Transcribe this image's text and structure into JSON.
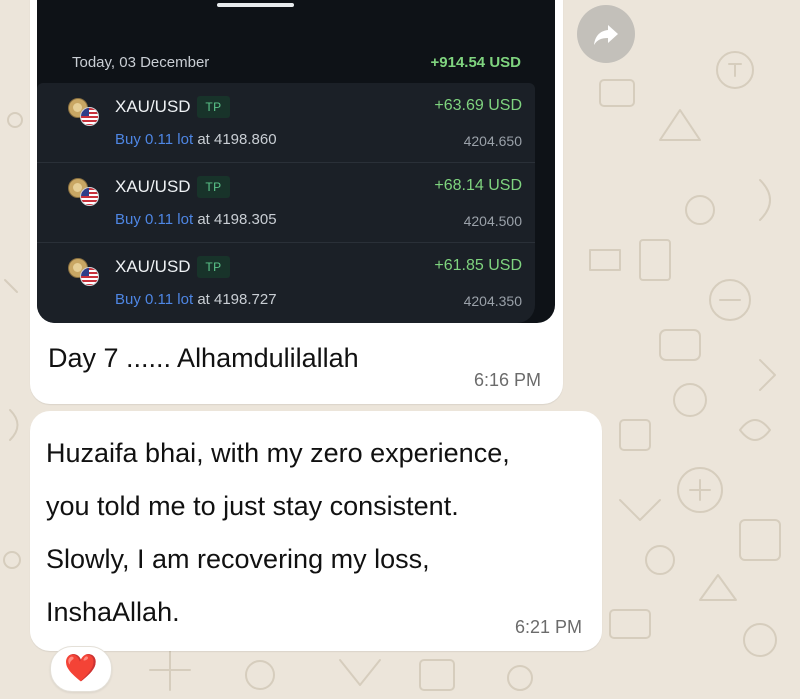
{
  "trading_screenshot": {
    "date_label": "Today, 03 December",
    "day_total": "+914.54 USD",
    "trades": [
      {
        "pair": "XAU/USD",
        "badge": "TP",
        "side": "Buy",
        "volume": "0.11",
        "unit": "lot",
        "at_label": "at",
        "open_price": "4198.860",
        "profit": "+63.69 USD",
        "close_price": "4204.650"
      },
      {
        "pair": "XAU/USD",
        "badge": "TP",
        "side": "Buy",
        "volume": "0.11",
        "unit": "lot",
        "at_label": "at",
        "open_price": "4198.305",
        "profit": "+68.14 USD",
        "close_price": "4204.500"
      },
      {
        "pair": "XAU/USD",
        "badge": "TP",
        "side": "Buy",
        "volume": "0.11",
        "unit": "lot",
        "at_label": "at",
        "open_price": "4198.727",
        "profit": "+61.85 USD",
        "close_price": "4204.350"
      }
    ]
  },
  "message1": {
    "caption": "Day 7 ...... Alhamdulilallah",
    "time": "6:16 PM"
  },
  "message2": {
    "lines": [
      "Huzaifa bhai, with my zero experience,",
      "you told me to just stay consistent.",
      "Slowly, I am recovering my loss,",
      "InshaAllah."
    ],
    "time": "6:21 PM"
  },
  "reaction": {
    "emoji": "❤️",
    "icon": "heart-icon"
  },
  "forward_button": {
    "icon": "forward-arrow-icon"
  },
  "colors": {
    "chat_background": "#ece5da",
    "bubble": "#ffffff",
    "profit_green": "#7fd47f",
    "buy_blue": "#4e86e4",
    "screenshot_dark": "#0e1217"
  }
}
